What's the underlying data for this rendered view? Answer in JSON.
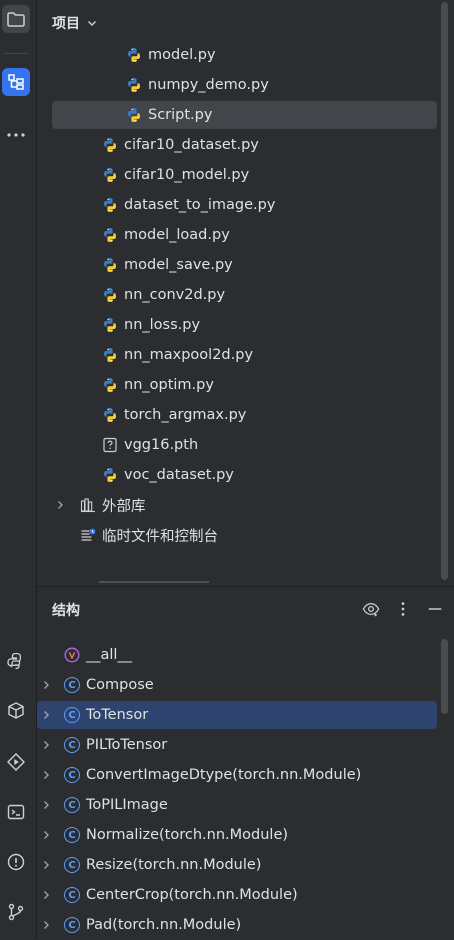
{
  "project_panel": {
    "title": "项目",
    "items": [
      {
        "label": "model.py",
        "icon": "python-file-icon",
        "indent": 3
      },
      {
        "label": "numpy_demo.py",
        "icon": "python-file-icon",
        "indent": 3
      },
      {
        "label": "Script.py",
        "icon": "python-file-icon",
        "indent": 3,
        "selected": true
      },
      {
        "label": "cifar10_dataset.py",
        "icon": "python-file-icon",
        "indent": 2
      },
      {
        "label": "cifar10_model.py",
        "icon": "python-file-icon",
        "indent": 2
      },
      {
        "label": "dataset_to_image.py",
        "icon": "python-file-icon",
        "indent": 2
      },
      {
        "label": "model_load.py",
        "icon": "python-file-icon",
        "indent": 2
      },
      {
        "label": "model_save.py",
        "icon": "python-file-icon",
        "indent": 2
      },
      {
        "label": "nn_conv2d.py",
        "icon": "python-file-icon",
        "indent": 2
      },
      {
        "label": "nn_loss.py",
        "icon": "python-file-icon",
        "indent": 2
      },
      {
        "label": "nn_maxpool2d.py",
        "icon": "python-file-icon",
        "indent": 2
      },
      {
        "label": "nn_optim.py",
        "icon": "python-file-icon",
        "indent": 2
      },
      {
        "label": "torch_argmax.py",
        "icon": "python-file-icon",
        "indent": 2
      },
      {
        "label": "vgg16.pth",
        "icon": "unknown-file-icon",
        "indent": 2
      },
      {
        "label": "voc_dataset.py",
        "icon": "python-file-icon",
        "indent": 2
      },
      {
        "label": "外部库",
        "icon": "library-icon",
        "indent": 0,
        "expandable": true
      },
      {
        "label": "临时文件和控制台",
        "icon": "scratches-icon",
        "indent": 0
      }
    ]
  },
  "structure_panel": {
    "title": "结构",
    "items": [
      {
        "label": "__all__",
        "icon": "variable-icon",
        "expandable": false
      },
      {
        "label": "Compose",
        "icon": "class-icon",
        "expandable": true
      },
      {
        "label": "ToTensor",
        "icon": "class-icon",
        "expandable": true,
        "selected": true
      },
      {
        "label": "PILToTensor",
        "icon": "class-icon",
        "expandable": true
      },
      {
        "label": "ConvertImageDtype(torch.nn.Module)",
        "icon": "class-icon",
        "expandable": true
      },
      {
        "label": "ToPILImage",
        "icon": "class-icon",
        "expandable": true
      },
      {
        "label": "Normalize(torch.nn.Module)",
        "icon": "class-icon",
        "expandable": true
      },
      {
        "label": "Resize(torch.nn.Module)",
        "icon": "class-icon",
        "expandable": true
      },
      {
        "label": "CenterCrop(torch.nn.Module)",
        "icon": "class-icon",
        "expandable": true
      },
      {
        "label": "Pad(torch.nn.Module)",
        "icon": "class-icon",
        "expandable": true
      }
    ]
  },
  "colors": {
    "background": "#2b2d30",
    "selection": "#43454a",
    "focus_selection": "#2e436e",
    "accent": "#3574f0"
  }
}
